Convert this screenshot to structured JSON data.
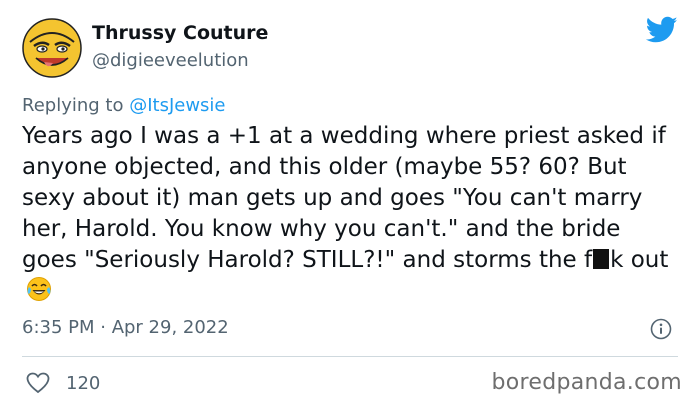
{
  "author": {
    "name": "Thrussy Couture",
    "handle": "@digieeveelution"
  },
  "reply": {
    "prefix": "Replying to ",
    "mention": "@ItsJewsie"
  },
  "tweet": {
    "text_before": "Years ago I was a +1 at a wedding where priest asked if anyone objected, and this older (maybe 55? 60? But sexy about it) man gets up and goes \"You can't marry her, Harold. You know why you can't.\" and the bride goes \"Seriously Harold? STILL?!\" and storms the f",
    "text_after": "k out",
    "emoji": "laughing-tears-emoji"
  },
  "meta": {
    "timestamp": "6:35 PM · Apr 29, 2022"
  },
  "engagement": {
    "likes": "120"
  },
  "watermark": "boredpanda.com",
  "colors": {
    "brand_blue": "#1d9bf0",
    "secondary_text": "#536471",
    "primary_text": "#0f1419"
  },
  "icons": {
    "platform": "twitter-bird-icon",
    "info": "info-icon",
    "like": "heart-icon"
  }
}
